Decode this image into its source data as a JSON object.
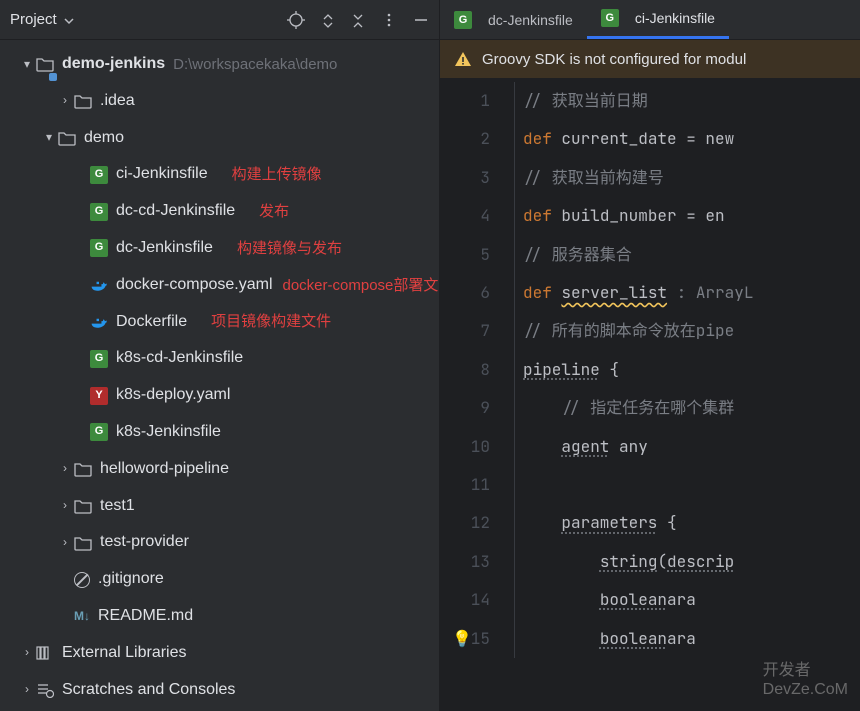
{
  "sidebar": {
    "title": "Project",
    "root": {
      "name": "demo-jenkins",
      "path": "D:\\workspacekaka\\demo"
    },
    "items": [
      {
        "name": ".idea",
        "type": "folder"
      },
      {
        "name": "demo",
        "type": "folder",
        "expanded": true
      },
      {
        "name": "ci-Jenkinsfile",
        "type": "groovy",
        "annotation": "构建上传镜像"
      },
      {
        "name": "dc-cd-Jenkinsfile",
        "type": "groovy",
        "annotation": "发布"
      },
      {
        "name": "dc-Jenkinsfile",
        "type": "groovy",
        "annotation": "构建镜像与发布"
      },
      {
        "name": "docker-compose.yaml",
        "type": "docker",
        "annotation": "docker-compose部署文件"
      },
      {
        "name": "Dockerfile",
        "type": "docker",
        "annotation": "项目镜像构建文件"
      },
      {
        "name": "k8s-cd-Jenkinsfile",
        "type": "groovy"
      },
      {
        "name": "k8s-deploy.yaml",
        "type": "yaml"
      },
      {
        "name": "k8s-Jenkinsfile",
        "type": "groovy"
      },
      {
        "name": "helloword-pipeline",
        "type": "folder"
      },
      {
        "name": "test1",
        "type": "folder"
      },
      {
        "name": "test-provider",
        "type": "folder"
      },
      {
        "name": ".gitignore",
        "type": "ignore"
      },
      {
        "name": "README.md",
        "type": "md",
        "icon_text": "M↓"
      }
    ],
    "external_libraries": "External Libraries",
    "scratches": "Scratches and Consoles"
  },
  "tabs": [
    {
      "label": "dc-Jenkinsfile",
      "active": false
    },
    {
      "label": "ci-Jenkinsfile",
      "active": true
    }
  ],
  "notification": "Groovy SDK is not configured for modul",
  "editor": {
    "lines": [
      {
        "n": 1,
        "comment": "// 获取当前日期"
      },
      {
        "n": 2,
        "kw": "def",
        "id": "current_date",
        "rest": " = new"
      },
      {
        "n": 3,
        "comment": "// 获取当前构建号"
      },
      {
        "n": 4,
        "kw": "def",
        "id": "build_number",
        "rest": " = en"
      },
      {
        "n": 5,
        "comment": "// 服务器集合",
        "over": "服务"
      },
      {
        "n": 6,
        "kw": "def",
        "id": "server_list",
        "hint": " : ArrayL"
      },
      {
        "n": 7,
        "comment": "// 所有的脚本命令放在pipe"
      },
      {
        "n": 8,
        "fn": "pipeline",
        "brace": " {"
      },
      {
        "n": 9,
        "indent1": true,
        "comment": "// 指定任务在哪个集群"
      },
      {
        "n": 10,
        "indent1": true,
        "fn": "agent",
        "rest": " any"
      },
      {
        "n": 11,
        "blank": true
      },
      {
        "n": 12,
        "indent1": true,
        "fn": "parameters",
        "brace": " {"
      },
      {
        "n": 13,
        "indent2": true,
        "fn": "string",
        "paren": "(",
        "arg": "descrip"
      },
      {
        "n": 14,
        "indent2": true,
        "fn_partial": "boolean",
        "rest_partial": "ara"
      },
      {
        "n": 15,
        "indent2": true,
        "fn_partial": "boolean",
        "rest_partial": "ara",
        "bulb": true
      }
    ]
  },
  "watermark": {
    "line1": "开发者",
    "line2": "DevZe.CoM"
  }
}
